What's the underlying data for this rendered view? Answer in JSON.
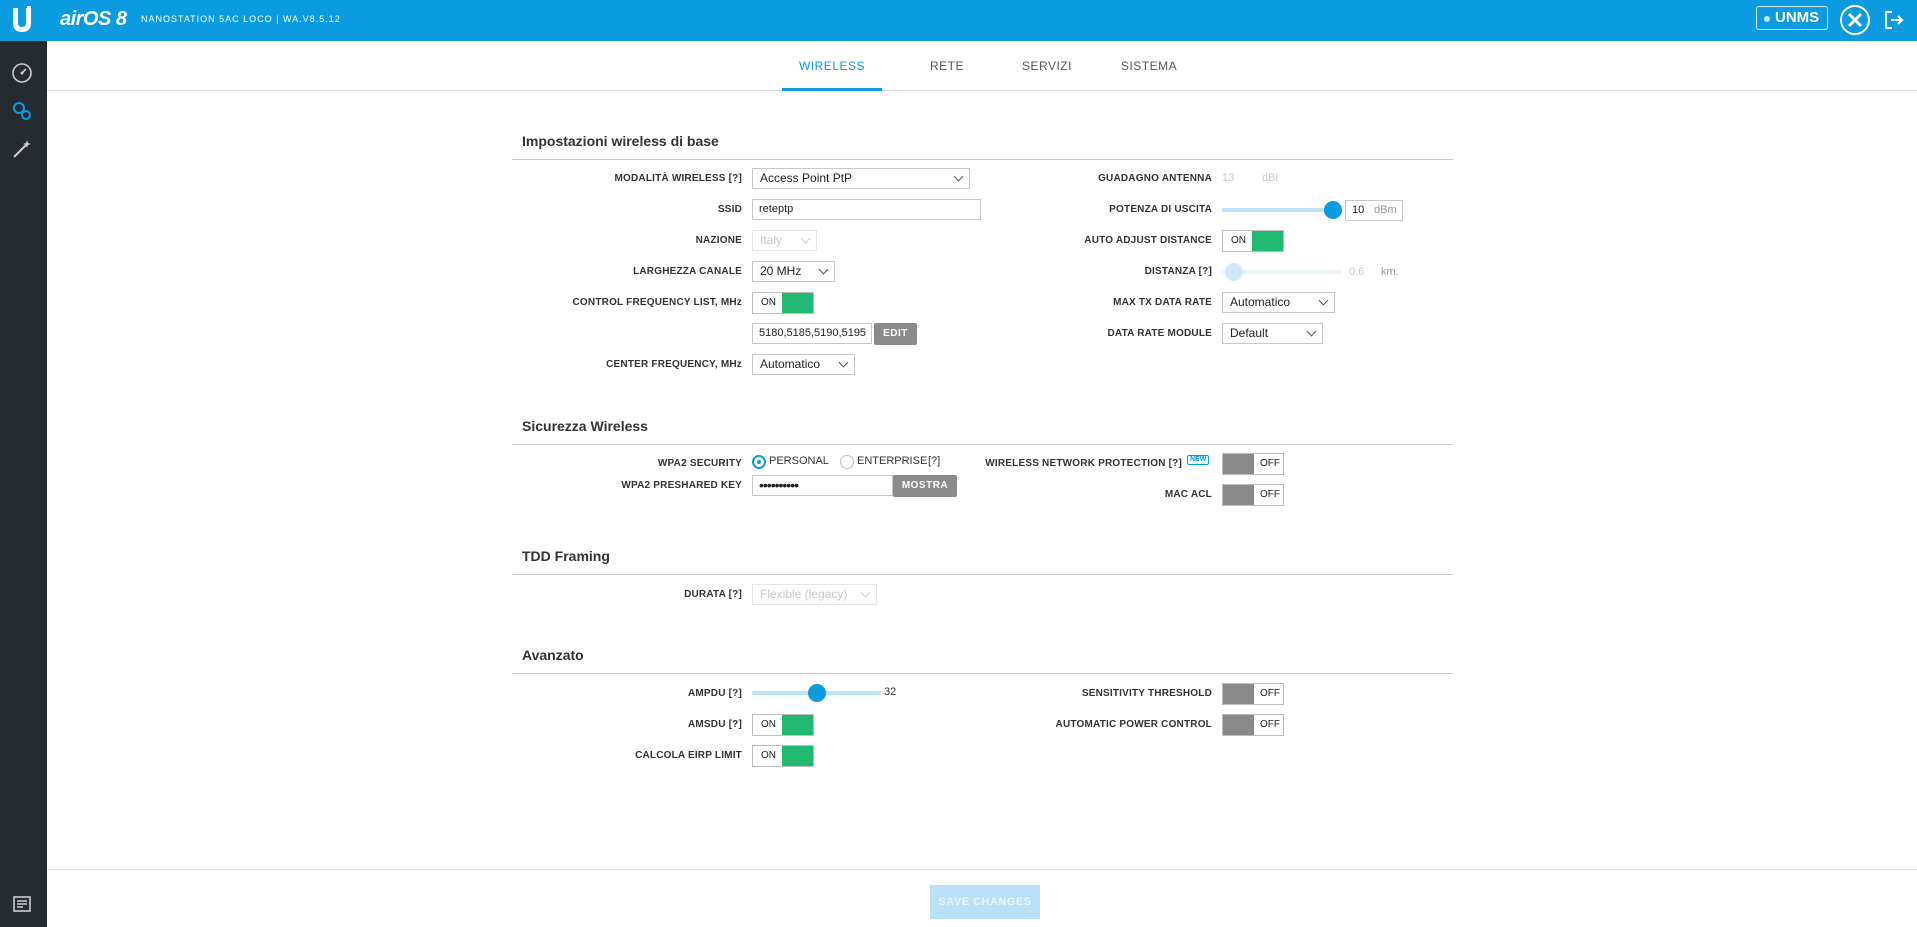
{
  "header": {
    "brand": "airOS 8",
    "device_name": "NANOSTATION 5AC LOCO | WA.V8.5.12",
    "unms_label": "UNMS"
  },
  "tabs": [
    {
      "label": "WIRELESS",
      "active": true
    },
    {
      "label": "RETE",
      "active": false
    },
    {
      "label": "SERVIZI",
      "active": false
    },
    {
      "label": "SISTEMA",
      "active": false
    }
  ],
  "basic": {
    "title": "Impostazioni wireless di base",
    "wireless_mode_label": "MODALITÀ WIRELESS [?]",
    "wireless_mode_value": "Access Point PtP",
    "ssid_label": "SSID",
    "ssid_value": "reteptp",
    "country_label": "NAZIONE",
    "country_value": "Italy",
    "channel_width_label": "LARGHEZZA CANALE",
    "channel_width_value": "20 MHz",
    "control_freq_label": "CONTROL FREQUENCY LIST, MHz",
    "control_freq_toggle": "ON",
    "control_freq_value": "5180,5185,5190,5195",
    "edit_label": "EDIT",
    "center_freq_label": "CENTER FREQUENCY, MHz",
    "center_freq_value": "Automatico",
    "antenna_gain_label": "GUADAGNO ANTENNA",
    "antenna_gain_value": "13",
    "antenna_gain_unit": "dBi",
    "output_power_label": "POTENZA DI USCITA",
    "output_power_value": "10",
    "output_power_unit": "dBm",
    "output_power_fraction": 1.0,
    "auto_adjust_label": "AUTO ADJUST DISTANCE",
    "auto_adjust_toggle": "ON",
    "distance_label": "DISTANZA [?]",
    "distance_value": "0.6",
    "distance_unit": "km.",
    "max_tx_label": "MAX TX DATA RATE",
    "max_tx_value": "Automatico",
    "data_rate_module_label": "DATA RATE MODULE",
    "data_rate_module_value": "Default"
  },
  "security": {
    "title": "Sicurezza Wireless",
    "wpa2_label": "WPA2 SECURITY",
    "personal_label": "PERSONAL",
    "enterprise_label": "ENTERPRISE",
    "help_label": "[?]",
    "preshared_label": "WPA2 PRESHARED KEY",
    "preshared_value": "••••••••••",
    "show_label": "MOSTRA",
    "wnp_label": "WIRELESS NETWORK PROTECTION [?]",
    "new_badge": "NEW",
    "wnp_toggle": "OFF",
    "mac_acl_label": "MAC ACL",
    "mac_acl_toggle": "OFF"
  },
  "tdd": {
    "title": "TDD Framing",
    "duration_label": "DURATA [?]",
    "duration_value": "Flexible (legacy)"
  },
  "advanced": {
    "title": "Avanzato",
    "ampdu_label": "AMPDU [?]",
    "ampdu_value": "32",
    "ampdu_fraction": 0.5,
    "amsdu_label": "AMSDU [?]",
    "amsdu_toggle": "ON",
    "eirp_label": "CALCOLA EIRP LIMIT",
    "eirp_toggle": "ON",
    "sensitivity_label": "SENSITIVITY THRESHOLD",
    "sensitivity_toggle": "OFF",
    "apc_label": "AUTOMATIC POWER CONTROL",
    "apc_toggle": "OFF"
  },
  "footer": {
    "save_label": "SAVE CHANGES"
  },
  "colors": {
    "accent": "#0a9be0",
    "toggle_on": "#20b96f",
    "toggle_off": "#8a8a8a",
    "sidebar": "#262a31"
  },
  "icons": {
    "sidebar": [
      "dashboard-icon",
      "settings-gears-icon",
      "wand-tools-icon",
      "message-icon"
    ],
    "header": [
      "ubiquiti-logo-icon",
      "tools-icon",
      "logout-icon"
    ]
  }
}
